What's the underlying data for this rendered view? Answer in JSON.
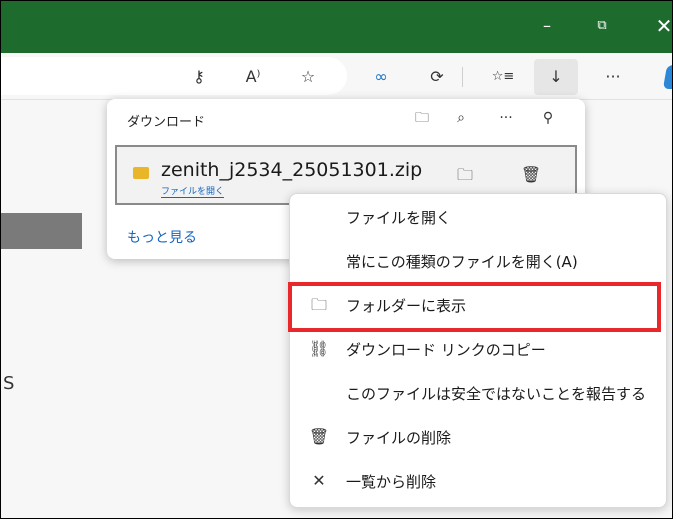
{
  "titlebar": {
    "min_glyph": "–",
    "restore_glyph": "⧉",
    "close_glyph": "✕"
  },
  "toolbar": {
    "icons": [
      "key-icon",
      "read-aloud-icon",
      "favorite-star-icon",
      "copilot-icon",
      "extension-icon",
      "favorites-icon",
      "download-icon",
      "more-icon"
    ],
    "glyphs": {
      "key": "⚷",
      "read": "A⁾",
      "star": "☆",
      "copilot": "∞",
      "ext": "⟳",
      "favs": "☆≡",
      "download": "↓",
      "more": "···"
    }
  },
  "download_panel": {
    "title": "ダウンロード",
    "item": {
      "filename": "zenith_j2534_25051301.zip",
      "open_link": "ファイルを開く"
    },
    "more_link": "もっと見る",
    "glyphs": {
      "folder": "🗀",
      "search": "⌕",
      "more": "···",
      "pin": "⚲",
      "trash": "🗑"
    }
  },
  "context_menu": {
    "items": [
      {
        "label": "ファイルを開く",
        "icon": ""
      },
      {
        "label": "常にこの種類のファイルを開く(A)",
        "icon": ""
      },
      {
        "label": "フォルダーに表示",
        "icon": "🗀"
      },
      {
        "label": "ダウンロード リンクのコピー",
        "icon": "⛓"
      },
      {
        "label": "このファイルは安全ではないことを報告する",
        "icon": ""
      },
      {
        "label": "ファイルの削除",
        "icon": "🗑"
      },
      {
        "label": "一覧から削除",
        "icon": "✕"
      }
    ]
  },
  "page": {
    "edge_char": "S"
  },
  "colors": {
    "titlebar": "#1e6b2e",
    "highlight": "#e8282b",
    "link": "#1565c0"
  }
}
